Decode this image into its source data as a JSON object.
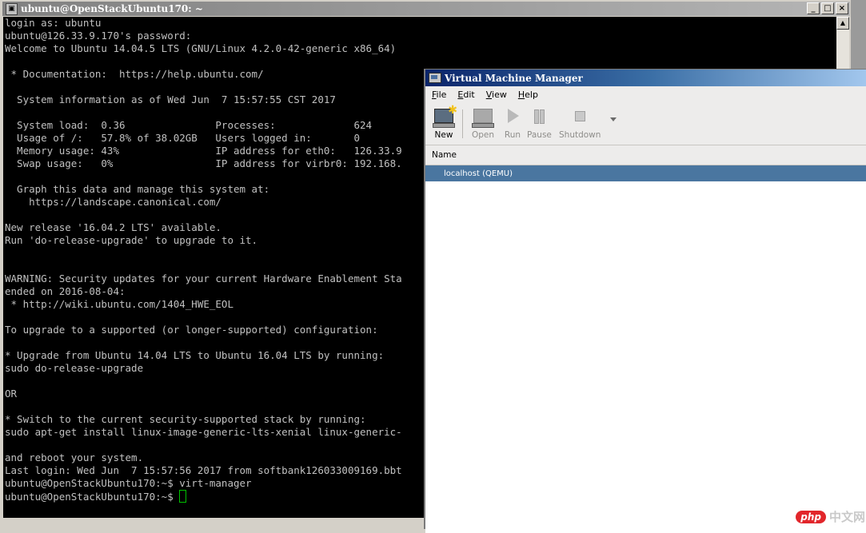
{
  "terminal": {
    "title": "ubuntu@OpenStackUbuntu170: ~",
    "icon": "putty-icon",
    "window_buttons": [
      "_",
      "□",
      "×"
    ],
    "lines": [
      "login as: ubuntu",
      "ubuntu@126.33.9.170's password:",
      "Welcome to Ubuntu 14.04.5 LTS (GNU/Linux 4.2.0-42-generic x86_64)",
      "",
      " * Documentation:  https://help.ubuntu.com/",
      "",
      "  System information as of Wed Jun  7 15:57:55 CST 2017",
      "",
      "  System load:  0.36               Processes:             624",
      "  Usage of /:   57.8% of 38.02GB   Users logged in:       0",
      "  Memory usage: 43%                IP address for eth0:   126.33.9",
      "  Swap usage:   0%                 IP address for virbr0: 192.168.",
      "",
      "  Graph this data and manage this system at:",
      "    https://landscape.canonical.com/",
      "",
      "New release '16.04.2 LTS' available.",
      "Run 'do-release-upgrade' to upgrade to it.",
      "",
      "",
      "WARNING: Security updates for your current Hardware Enablement Sta",
      "ended on 2016-08-04:",
      " * http://wiki.ubuntu.com/1404_HWE_EOL",
      "",
      "To upgrade to a supported (or longer-supported) configuration:",
      "",
      "* Upgrade from Ubuntu 14.04 LTS to Ubuntu 16.04 LTS by running:",
      "sudo do-release-upgrade",
      "",
      "OR",
      "",
      "* Switch to the current security-supported stack by running:",
      "sudo apt-get install linux-image-generic-lts-xenial linux-generic-",
      "",
      "and reboot your system.",
      "Last login: Wed Jun  7 15:57:56 2017 from softbank126033009169.bbt",
      "ubuntu@OpenStackUbuntu170:~$ virt-manager"
    ],
    "prompt": "ubuntu@OpenStackUbuntu170:~$ "
  },
  "vmm": {
    "title": "Virtual Machine Manager",
    "menu": [
      {
        "label": "File",
        "accel": "F",
        "rest": "ile"
      },
      {
        "label": "Edit",
        "accel": "E",
        "rest": "dit"
      },
      {
        "label": "View",
        "accel": "V",
        "rest": "iew"
      },
      {
        "label": "Help",
        "accel": "H",
        "rest": "elp"
      }
    ],
    "toolbar": {
      "new": "New",
      "open": "Open",
      "run": "Run",
      "pause": "Pause",
      "shutdown": "Shutdown"
    },
    "column_header": "Name",
    "connections": [
      {
        "name": "localhost (QEMU)",
        "selected": true
      }
    ]
  },
  "watermark": {
    "logo": "php",
    "text": "中文网"
  },
  "colors": {
    "terminal_bg": "#000000",
    "terminal_fg": "#c0c0c0",
    "cursor": "#00c000",
    "vmm_title": "#0a246a",
    "selection": "#4a76a0"
  }
}
